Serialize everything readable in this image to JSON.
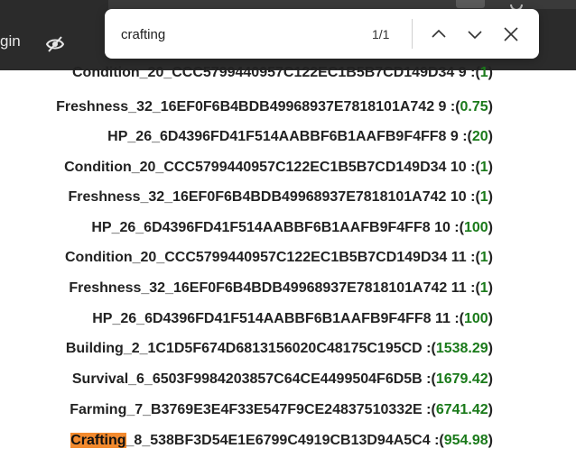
{
  "topbar": {
    "login_fragment": "gin",
    "eye_icon": "eye-slash-icon"
  },
  "find": {
    "query": "crafting",
    "count": "1/1",
    "prev_icon": "chevron-up-icon",
    "next_icon": "chevron-down-icon",
    "close_icon": "close-icon"
  },
  "rows": [
    {
      "label": "Condition_20_CCC5799440957C122EC1B5B7CD149D34 9 :",
      "value": "1"
    },
    {
      "label": "Freshness_32_16EF0F6B4BDB49968937E7818101A742 9 :",
      "value": "0.75"
    },
    {
      "label": "HP_26_6D4396FD41F514AABBF6B1AAFB9F4FF8 9 :",
      "value": "20"
    },
    {
      "label": "Condition_20_CCC5799440957C122EC1B5B7CD149D34 10 :",
      "value": "1"
    },
    {
      "label": "Freshness_32_16EF0F6B4BDB49968937E7818101A742 10 :",
      "value": "1"
    },
    {
      "label": "HP_26_6D4396FD41F514AABBF6B1AAFB9F4FF8 10 :",
      "value": "100"
    },
    {
      "label": "Condition_20_CCC5799440957C122EC1B5B7CD149D34 11 :",
      "value": "1"
    },
    {
      "label": "Freshness_32_16EF0F6B4BDB49968937E7818101A742 11 :",
      "value": "1"
    },
    {
      "label": "HP_26_6D4396FD41F514AABBF6B1AAFB9F4FF8 11 :",
      "value": "100"
    },
    {
      "label": "Building_2_1C1D5F674D6813156020C48175C195CD :",
      "value": "1538.29"
    },
    {
      "label": "Survival_6_6503F9984203857C64CE4499504F6D5B :",
      "value": "1679.42"
    },
    {
      "label": "Farming_7_B3769E3E4F33E547F9CE24837510332E :",
      "value": "6741.42"
    },
    {
      "label_highlight": "Crafting",
      "label": "_8_538BF3D54E1E6799C4919CB13D94A5C4 :",
      "value": "954.98"
    }
  ],
  "colors": {
    "value_green": "#1a7a1a",
    "highlight": "#f28a2e",
    "topbar": "#2b2b2b"
  }
}
